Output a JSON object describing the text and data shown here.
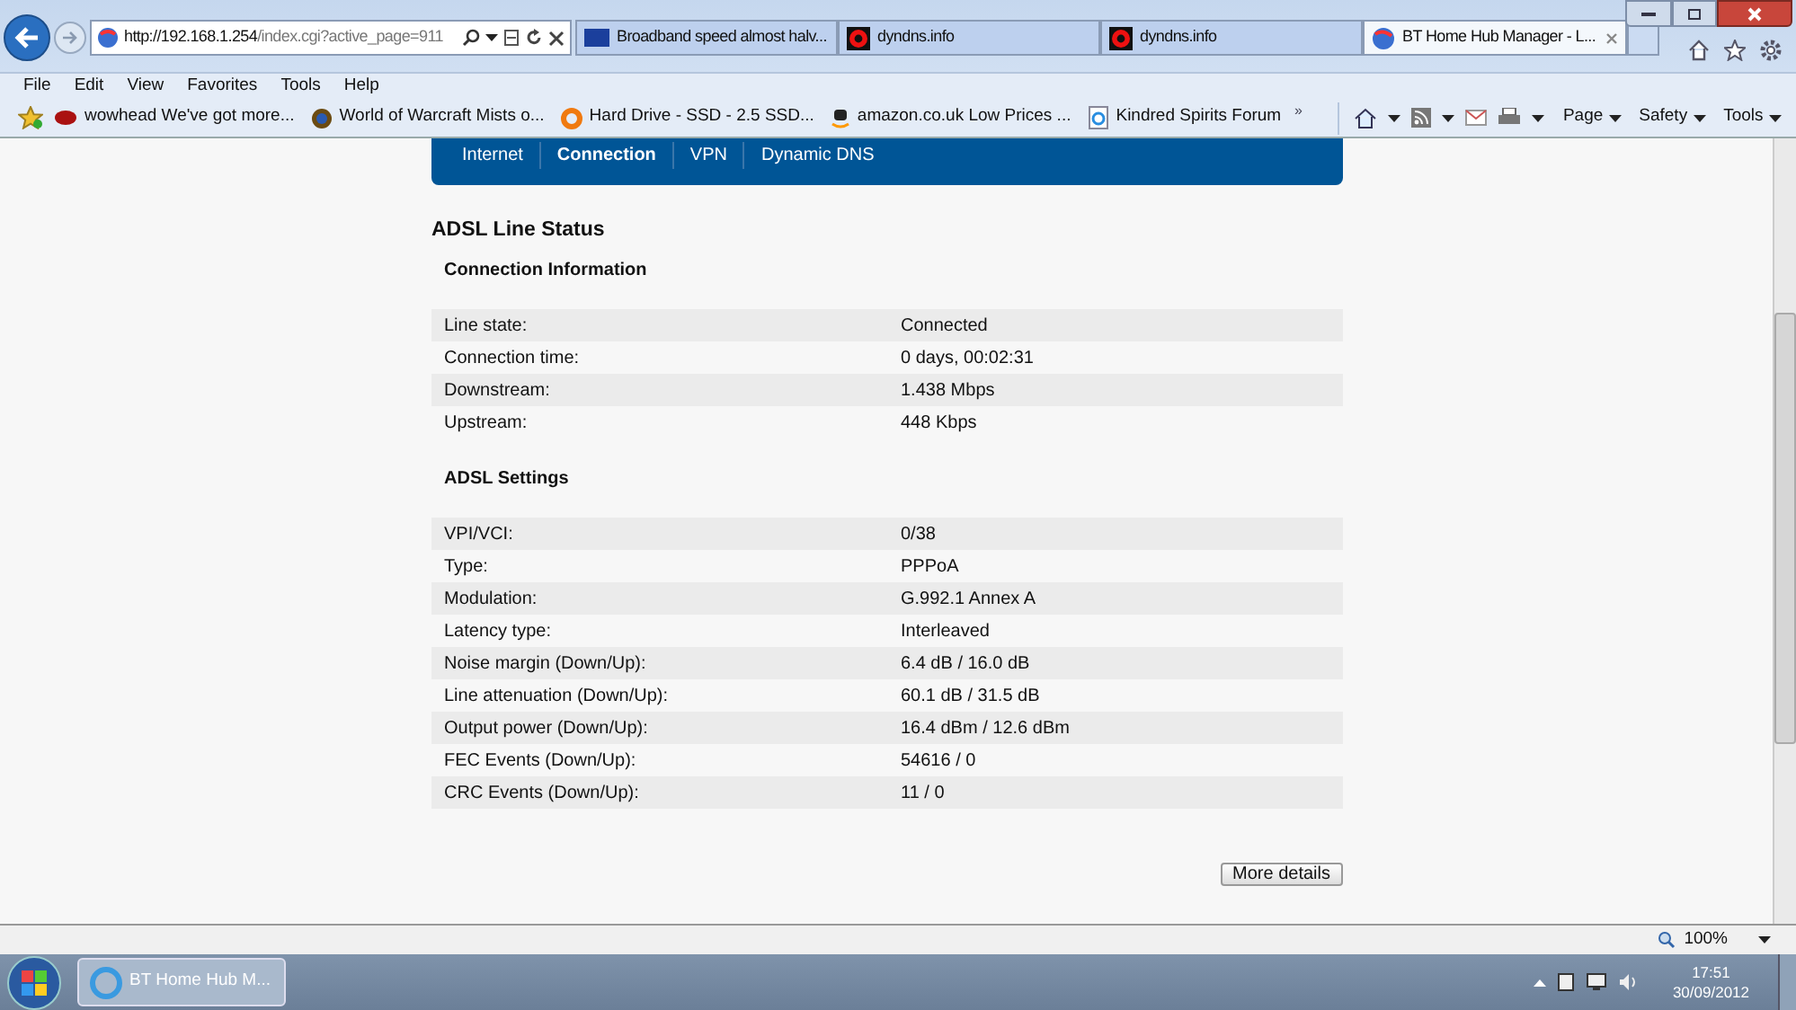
{
  "browser": {
    "address": {
      "host": "http://192.168.1.254",
      "path": "/index.cgi?active_page=911"
    },
    "tabs": [
      {
        "label": "Broadband speed almost halv...",
        "selected": false,
        "kind": "bt"
      },
      {
        "label": "dyndns.info",
        "selected": false,
        "kind": "dyn"
      },
      {
        "label": "dyndns.info",
        "selected": false,
        "kind": "dyn"
      },
      {
        "label": "BT Home Hub Manager - L...",
        "selected": true,
        "kind": "globe"
      }
    ],
    "menu": [
      "File",
      "Edit",
      "View",
      "Favorites",
      "Tools",
      "Help"
    ],
    "favorites": [
      {
        "label": "wowhead We've got more...",
        "kind": "wowhead"
      },
      {
        "label": "World of Warcraft Mists o...",
        "kind": "wow"
      },
      {
        "label": "Hard Drive - SSD - 2.5 SSD...",
        "kind": "e"
      },
      {
        "label": "amazon.co.uk Low Prices ...",
        "kind": "amazon"
      },
      {
        "label": "Kindred Spirits Forum",
        "kind": "ie"
      }
    ],
    "overflow": "»",
    "commands": [
      "Page",
      "Safety",
      "Tools"
    ]
  },
  "page": {
    "nav": [
      {
        "label": "Internet",
        "selected": false
      },
      {
        "label": "Connection",
        "selected": true
      },
      {
        "label": "VPN",
        "selected": false
      },
      {
        "label": "Dynamic DNS",
        "selected": false
      }
    ],
    "title": "ADSL Line Status",
    "sections": [
      {
        "heading": "Connection Information",
        "rows": [
          {
            "label": "Line state:",
            "value": "Connected"
          },
          {
            "label": "Connection time:",
            "value": "0 days, 00:02:31"
          },
          {
            "label": "Downstream:",
            "value": "1.438 Mbps"
          },
          {
            "label": "Upstream:",
            "value": "448 Kbps"
          }
        ]
      },
      {
        "heading": "ADSL Settings",
        "rows": [
          {
            "label": "VPI/VCI:",
            "value": "0/38"
          },
          {
            "label": "Type:",
            "value": "PPPoA"
          },
          {
            "label": "Modulation:",
            "value": "G.992.1 Annex A"
          },
          {
            "label": "Latency type:",
            "value": "Interleaved"
          },
          {
            "label": "Noise margin (Down/Up):",
            "value": "6.4 dB / 16.0 dB"
          },
          {
            "label": "Line attenuation (Down/Up):",
            "value": "60.1 dB / 31.5 dB"
          },
          {
            "label": "Output power (Down/Up):",
            "value": "16.4 dBm / 12.6 dBm"
          },
          {
            "label": "FEC Events (Down/Up):",
            "value": "54616 / 0"
          },
          {
            "label": "CRC Events (Down/Up):",
            "value": "11 / 0"
          }
        ]
      }
    ],
    "button": "More details"
  },
  "status": {
    "zoom": "100%"
  },
  "taskbar": {
    "task": "BT Home Hub M...",
    "time": "17:51",
    "date": "30/09/2012"
  }
}
